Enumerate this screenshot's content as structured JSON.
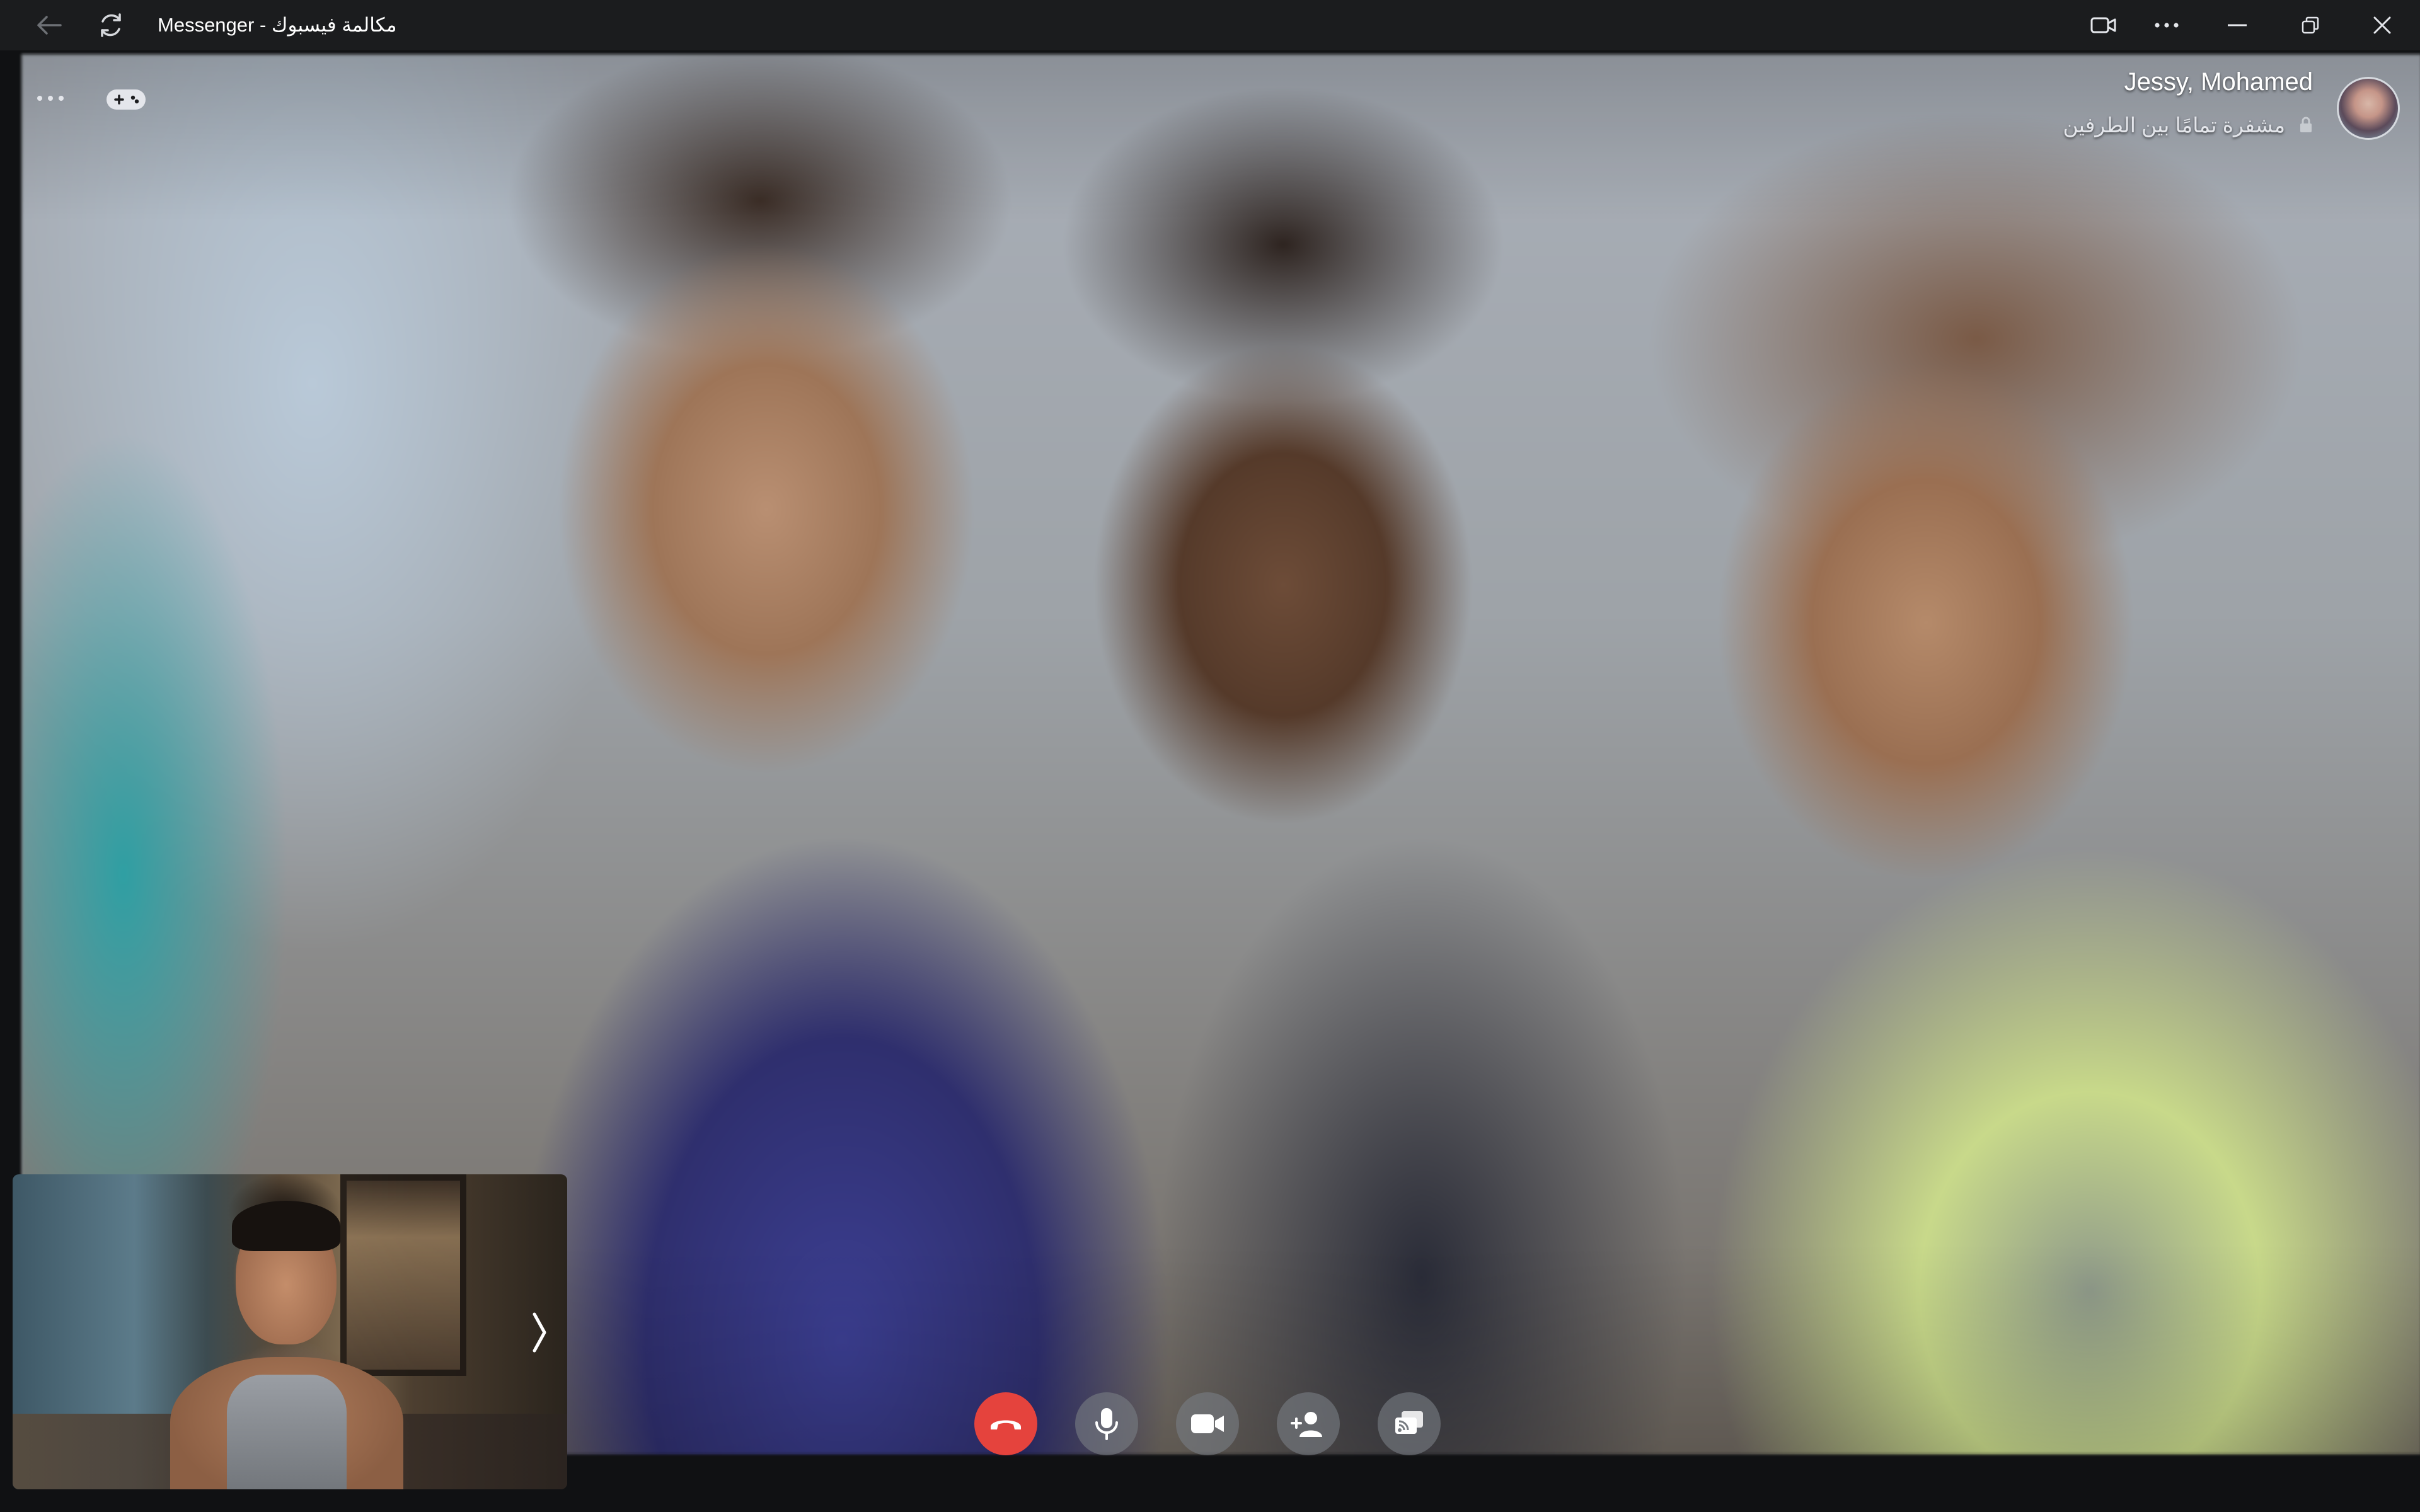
{
  "window": {
    "title": "Messenger - مكالمة فيسبوك"
  },
  "titlebar": {
    "icons": [
      "back-arrow-icon",
      "refresh-icon",
      "video-camera-icon",
      "more-horizontal-icon",
      "minimize-icon",
      "restore-icon",
      "close-icon"
    ]
  },
  "call": {
    "participants": "Jessy, Mohamed",
    "encryption_text": "مشفرة تمامًا بين الطرفين",
    "overlay_icons": [
      "more-options-icon",
      "game-controller-icon",
      "lock-icon"
    ],
    "self_view_toggle": "⟩"
  },
  "controls": {
    "items": [
      "end-call",
      "microphone",
      "camera",
      "add-person",
      "share-screen"
    ],
    "colors": {
      "end_call": "#e5433d",
      "control_bg": "#787c82"
    }
  },
  "colors": {
    "titlebar_bg": "#1b1c1e",
    "page_bg": "#101113",
    "text": "#ffffff"
  }
}
